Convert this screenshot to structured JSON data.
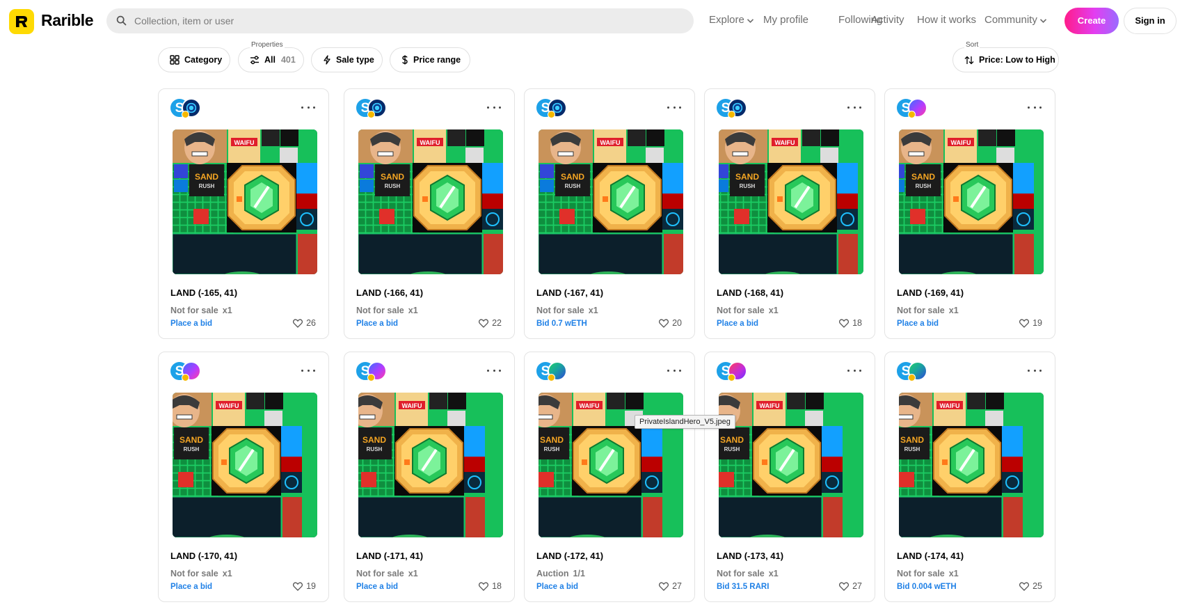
{
  "app": {
    "name": "Rarible"
  },
  "search": {
    "placeholder": "Collection, item or user"
  },
  "nav": [
    {
      "label": "Explore",
      "has_dropdown": true
    },
    {
      "label": "My profile",
      "has_dropdown": false
    },
    {
      "label": "Following",
      "has_dropdown": false
    },
    {
      "label": "Activity",
      "has_dropdown": false
    },
    {
      "label": "How it works",
      "has_dropdown": false
    },
    {
      "label": "Community",
      "has_dropdown": true
    }
  ],
  "buttons": {
    "create": "Create",
    "sign_in": "Sign in"
  },
  "filters": {
    "category": "Category",
    "properties_label": "Properties",
    "properties_value": "All",
    "properties_count": "401",
    "sale_type": "Sale type",
    "price_range": "Price range",
    "sort_label": "Sort",
    "sort_value": "Price: Low to High"
  },
  "colors": {
    "brand_yellow": "#FEDA03",
    "link_blue": "#1f80e6",
    "create_gradient_start": "#ff1c8a",
    "create_gradient_end": "#9b6bff"
  },
  "cards": [
    {
      "title": "LAND (-165, 41)",
      "sale": "Not for sale",
      "qty": "x1",
      "bid": "Place a bid",
      "likes": "26",
      "owner_avatar": "teal-blue"
    },
    {
      "title": "LAND (-166, 41)",
      "sale": "Not for sale",
      "qty": "x1",
      "bid": "Place a bid",
      "likes": "22",
      "owner_avatar": "teal-blue"
    },
    {
      "title": "LAND (-167, 41)",
      "sale": "Not for sale",
      "qty": "x1",
      "bid": "Bid 0.7 wETH",
      "likes": "20",
      "owner_avatar": "teal-blue"
    },
    {
      "title": "LAND (-168, 41)",
      "sale": "Not for sale",
      "qty": "x1",
      "bid": "Place a bid",
      "likes": "18",
      "owner_avatar": "teal-blue"
    },
    {
      "title": "LAND (-169, 41)",
      "sale": "Not for sale",
      "qty": "x1",
      "bid": "Place a bid",
      "likes": "19",
      "owner_avatar": "purple-pink"
    },
    {
      "title": "LAND (-170, 41)",
      "sale": "Not for sale",
      "qty": "x1",
      "bid": "Place a bid",
      "likes": "19",
      "owner_avatar": "purple-pink"
    },
    {
      "title": "LAND (-171, 41)",
      "sale": "Not for sale",
      "qty": "x1",
      "bid": "Place a bid",
      "likes": "18",
      "owner_avatar": "purple-pink"
    },
    {
      "title": "LAND (-172, 41)",
      "sale": "Auction",
      "qty": "1/1",
      "bid": "Place a bid",
      "likes": "27",
      "owner_avatar": "green-blue"
    },
    {
      "title": "LAND (-173, 41)",
      "sale": "Not for sale",
      "qty": "x1",
      "bid": "Bid 31.5 RARI",
      "likes": "27",
      "owner_avatar": "red-purple"
    },
    {
      "title": "LAND (-174, 41)",
      "sale": "Not for sale",
      "qty": "x1",
      "bid": "Bid 0.004 wETH",
      "likes": "25",
      "owner_avatar": "green-blue"
    }
  ],
  "tooltip": {
    "text": "PrivateIslandHero_V5.jpeg"
  }
}
